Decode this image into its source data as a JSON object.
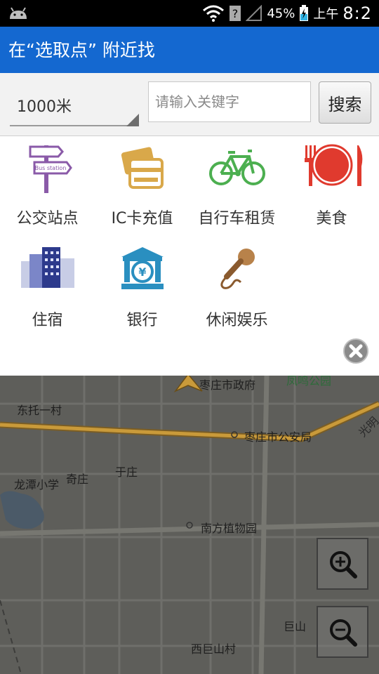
{
  "status_bar": {
    "battery_percent": "45%",
    "am_pm": "上午",
    "time": "8:2"
  },
  "title_bar": {
    "title": "在“选取点” 附近找"
  },
  "search": {
    "distance_value": "1000米",
    "placeholder": "请输入关键字",
    "button_label": "搜索"
  },
  "categories": [
    {
      "label": "公交站点",
      "icon": "bus-station-sign-icon",
      "sign_text": "Bus station"
    },
    {
      "label": "IC卡充值",
      "icon": "ic-card-icon"
    },
    {
      "label": "自行车租赁",
      "icon": "bicycle-icon"
    },
    {
      "label": "美食",
      "icon": "dining-icon"
    },
    {
      "label": "住宿",
      "icon": "hotel-buildings-icon"
    },
    {
      "label": "银行",
      "icon": "bank-icon"
    },
    {
      "label": "休闲娱乐",
      "icon": "microphone-icon"
    }
  ],
  "map": {
    "labels": {
      "gov": "枣庄市政府",
      "park": "凤鸣公园",
      "dongtuo": "东托一村",
      "police": "枣庄市公安局",
      "road": "光明",
      "longtan": "龙潭小学",
      "qizhuang": "奇庄",
      "yuzhuang": "于庄",
      "botanic": "南方植物园",
      "jushan": "巨山",
      "xijushan": "西巨山村"
    }
  },
  "colors": {
    "title_bar": "#1468d0",
    "status_bar": "#000000",
    "road": "#c99a3a"
  }
}
